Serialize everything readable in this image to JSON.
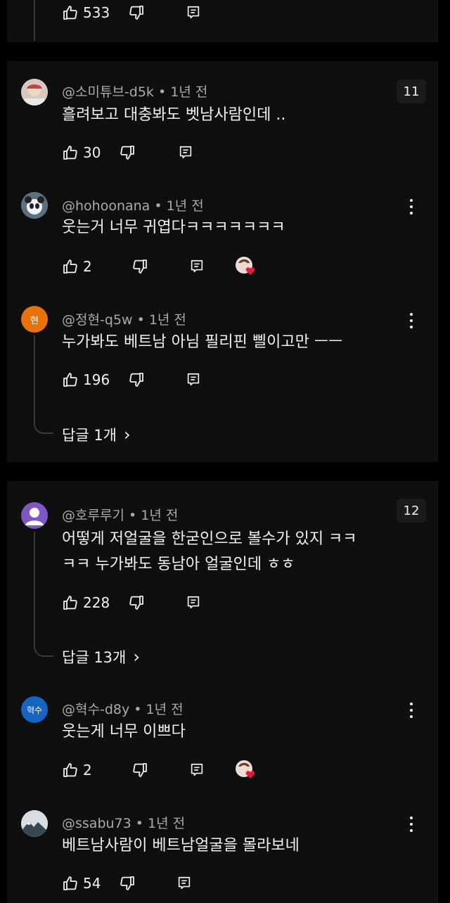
{
  "comments": [
    {
      "likes": "533"
    },
    {
      "author": "@소미튜브-d5k",
      "time": "1년 전",
      "text": "흘려보고 대충봐도 벳남사람인데 ..",
      "likes": "30",
      "badge": "11"
    },
    {
      "author": "@hohoonana",
      "time": "1년 전",
      "text": "웃는거 너무 귀엽다ㅋㅋㅋㅋㅋㅋㅋ",
      "likes": "2"
    },
    {
      "author": "@정현-q5w",
      "time": "1년 전",
      "text": "누가봐도 베트남 아님 필리핀 삘이고만 ㅡㅡ",
      "likes": "196",
      "replies": "답글 1개",
      "avatar_text": "현"
    },
    {
      "author": "@호루루기",
      "time": "1년 전",
      "text_line1": "어떻게 저얼굴을 한굳인으로 볼수가 있지 ㅋㅋ",
      "text_line2": "ㅋㅋ 누가봐도 동남아 얼굴인데 ㅎㅎ",
      "likes": "228",
      "replies": "답글 13개",
      "badge": "12"
    },
    {
      "author": "@혁수-d8y",
      "time": "1년 전",
      "text": "웃는게 너무 이쁘다",
      "likes": "2",
      "avatar_text": "혁수"
    },
    {
      "author": "@ssabu73",
      "time": "1년 전",
      "text": "베트남사람이 베트남얼굴을 몰라보네",
      "likes": "54"
    }
  ],
  "meta_separator": "•",
  "reply_chevron": "›",
  "colors": {
    "background": "#000000",
    "card": "#0f0f0f",
    "meta_text": "#aaaaaa",
    "avatar_orange": "#e8710a",
    "avatar_purple": "#7e57c2",
    "avatar_blue": "#1565c0",
    "heart": "#e21b3c"
  },
  "icons": [
    "like-icon",
    "dislike-icon",
    "reply-icon",
    "more-vert-icon",
    "chevron-right-icon",
    "creator-heart-icon"
  ]
}
